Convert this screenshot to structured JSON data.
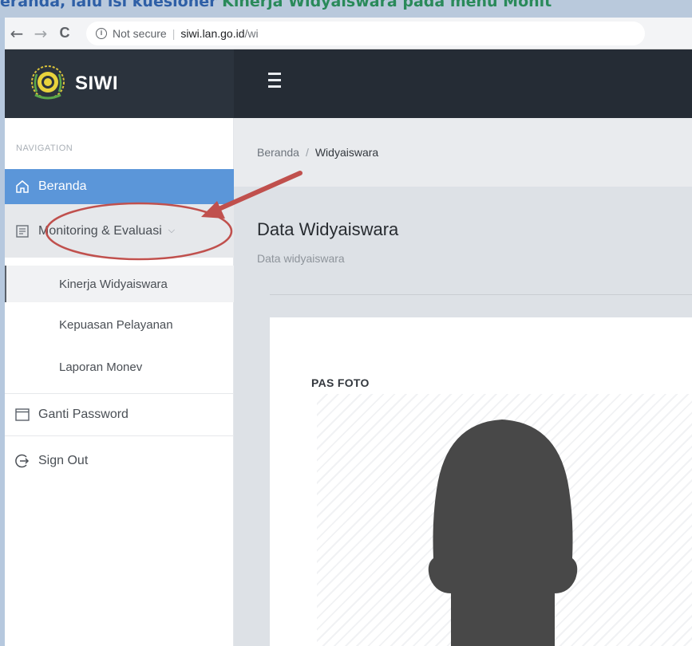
{
  "banner": {
    "text_prefix": "eranda, lalu isi kuesioner ",
    "text_highlight": "Kinerja Widyaiswara pada menu Monit"
  },
  "browser": {
    "back_symbol": "←",
    "forward_symbol": "→",
    "reload_symbol": "C",
    "security_label": "Not secure",
    "host": "siwi.lan.go.id",
    "path": "/wi"
  },
  "header": {
    "brand_name": "SIWI"
  },
  "sidebar": {
    "section_title": "NAVIGATION",
    "items": [
      {
        "label": "Beranda",
        "icon": "home-icon",
        "state": "active"
      },
      {
        "label": "Monitoring & Evaluasi",
        "icon": "document-icon",
        "state": "open"
      },
      {
        "label": "Ganti Password",
        "icon": "window-icon"
      },
      {
        "label": "Sign Out",
        "icon": "sign-out-icon"
      }
    ],
    "submenu": [
      {
        "label": "Kinerja Widyaiswara",
        "state": "current"
      },
      {
        "label": "Kepuasan Pelayanan"
      },
      {
        "label": "Laporan Monev"
      }
    ]
  },
  "main": {
    "breadcrumb": {
      "home": "Beranda",
      "separator": "/",
      "current": "Widyaiswara"
    },
    "title": "Data Widyaiswara",
    "subtitle": "Data widyaiswara",
    "card": {
      "photo_label": "PAS FOTO"
    }
  },
  "colors": {
    "active_item": "#5b96d9",
    "header_bg": "#252c35",
    "annotation": "#c0504d"
  }
}
